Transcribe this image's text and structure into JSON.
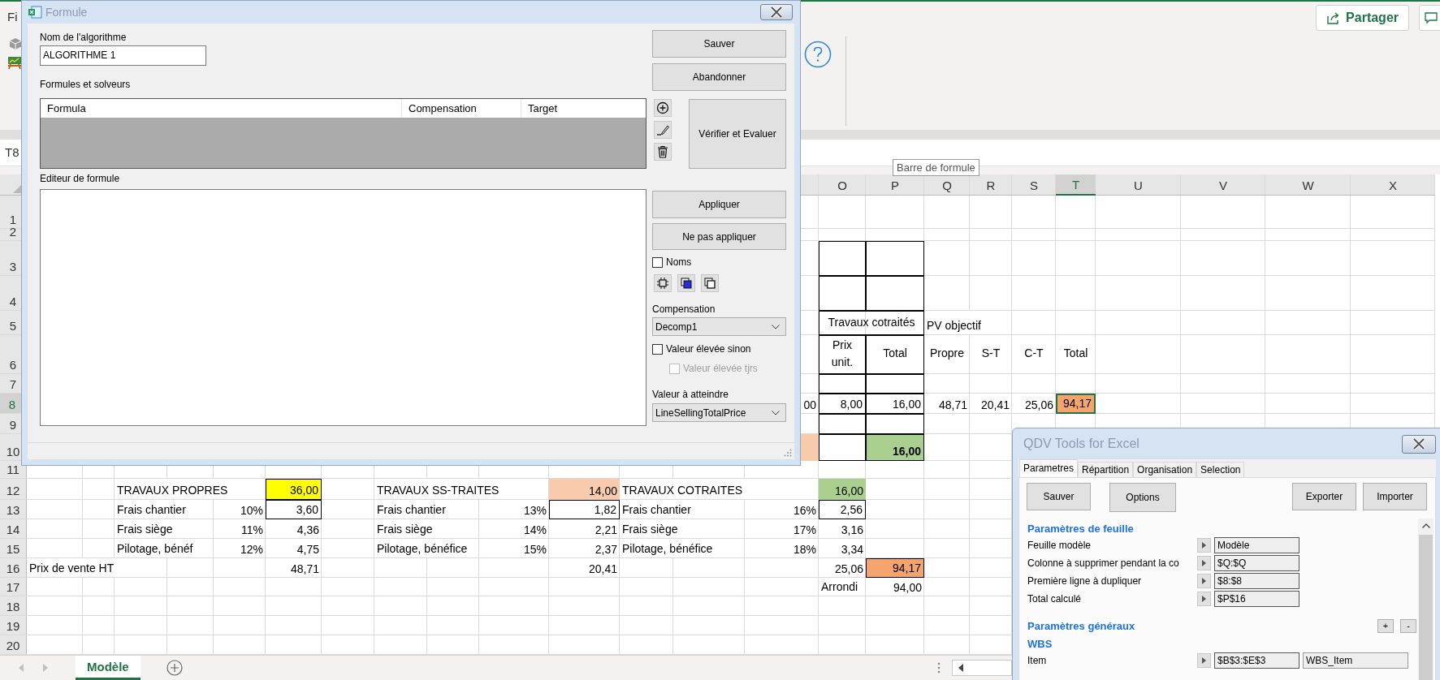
{
  "app": {
    "menu_fragment": "Fi",
    "share_button": "Partager",
    "name_box": "T8",
    "tooltip": "Barre de formule"
  },
  "sheet": {
    "column_headers": [
      {
        "label": "O",
        "selected": false
      },
      {
        "label": "P",
        "selected": false
      },
      {
        "label": "Q",
        "selected": false
      },
      {
        "label": "R",
        "selected": false
      },
      {
        "label": "S",
        "selected": false
      },
      {
        "label": "T",
        "selected": true
      },
      {
        "label": "U",
        "selected": false
      },
      {
        "label": "V",
        "selected": false
      },
      {
        "label": "W",
        "selected": false
      },
      {
        "label": "X",
        "selected": false
      }
    ],
    "rows": [
      {
        "number": "1",
        "selected": false
      },
      {
        "number": "2",
        "selected": false
      },
      {
        "number": "3",
        "selected": false,
        "cells": [
          "",
          "",
          "",
          "",
          "",
          "",
          "",
          "",
          "",
          "",
          "",
          "",
          "",
          "",
          {
            "kind": "blank",
            "boxed": true,
            "selected": false
          },
          {
            "kind": "blank",
            "boxed": true,
            "selected": false
          }
        ]
      },
      {
        "number": "4",
        "selected": false,
        "cells": [
          "",
          "",
          "",
          "",
          "",
          "",
          "",
          "",
          "",
          "",
          "",
          "",
          "",
          "",
          {
            "kind": "blank",
            "boxed": true,
            "selected": false
          },
          {
            "kind": "blank",
            "boxed": true,
            "selected": false
          }
        ]
      },
      {
        "number": "5",
        "selected": false,
        "cells": [
          "",
          "",
          "",
          "",
          "",
          "",
          "",
          "",
          "",
          "",
          "",
          "",
          "",
          "",
          {
            "kind": "merged",
            "text": "Travaux cotraités",
            "boxed": true,
            "selected": false
          },
          "",
          {
            "kind": "text",
            "text": "PV objectif",
            "boxed": false,
            "selected": false
          }
        ]
      },
      {
        "number": "6",
        "selected": false,
        "cells": [
          "",
          "",
          "",
          "",
          "",
          "",
          "",
          "",
          "",
          "",
          "",
          "",
          "",
          "",
          {
            "kind": "heading",
            "text": "Prix unit.",
            "boxed": true,
            "selected": false
          },
          {
            "kind": "heading",
            "text": "Total",
            "boxed": true,
            "selected": false
          },
          {
            "kind": "heading",
            "text": "Propre",
            "boxed": false,
            "selected": false
          },
          {
            "kind": "heading",
            "text": "S-T",
            "boxed": false,
            "selected": false
          },
          {
            "kind": "heading",
            "text": "C-T",
            "boxed": false,
            "selected": false
          },
          {
            "kind": "heading",
            "text": "Total",
            "boxed": false,
            "selected": false
          }
        ]
      },
      {
        "number": "7",
        "selected": false,
        "cells": [
          "",
          "",
          "",
          "",
          "",
          "",
          "",
          "",
          "",
          "",
          "",
          "",
          "",
          "",
          {
            "kind": "blank",
            "boxed": true,
            "selected": false
          },
          {
            "kind": "blank",
            "boxed": true,
            "selected": false
          }
        ]
      },
      {
        "number": "8",
        "selected": true,
        "cells": [
          "",
          "",
          "",
          "",
          "",
          "",
          "",
          "",
          "",
          "",
          "",
          "",
          "",
          {
            "kind": "number",
            "text": "00",
            "boxed": false,
            "selected": false
          },
          {
            "kind": "number",
            "text": "8,00",
            "boxed": true,
            "selected": false
          },
          {
            "kind": "number",
            "text": "16,00",
            "boxed": true,
            "selected": false
          },
          {
            "kind": "number",
            "text": "48,71",
            "boxed": false,
            "selected": false
          },
          {
            "kind": "number",
            "text": "20,41",
            "boxed": false,
            "selected": false
          },
          {
            "kind": "number",
            "text": "25,06",
            "boxed": false,
            "selected": false
          },
          {
            "kind": "number",
            "text": "94,17",
            "color": "#f4a46c",
            "boxed": false,
            "selected": true
          }
        ]
      },
      {
        "number": "9",
        "selected": false,
        "cells": [
          "",
          "",
          "",
          "",
          "",
          "",
          "",
          "",
          "",
          "",
          "",
          "",
          "",
          "",
          {
            "kind": "blank",
            "boxed": true,
            "selected": false
          },
          {
            "kind": "blank",
            "boxed": true,
            "selected": false
          }
        ]
      },
      {
        "number": "10",
        "selected": false,
        "cells": [
          "",
          "",
          "",
          "",
          "",
          "",
          "",
          "",
          "",
          "",
          "",
          "",
          "",
          {
            "kind": "blank",
            "color": "#f8cbad",
            "boxed": false,
            "selected": false
          },
          {
            "kind": "blank",
            "boxed": true,
            "selected": false
          },
          {
            "kind": "number",
            "text": "16,00",
            "bold": true,
            "color": "#a9d08e",
            "boxed": true,
            "selected": false
          }
        ]
      },
      {
        "number": "11",
        "selected": false
      },
      {
        "number": "12",
        "selected": false,
        "cells": [
          "",
          "",
          {
            "kind": "text",
            "text": "TRAVAUX PROPRES",
            "boxed": false,
            "selected": false
          },
          "",
          "",
          {
            "kind": "number",
            "text": "36,00",
            "color": "#ffff00",
            "boxed": true,
            "selected": false
          },
          "",
          {
            "kind": "text",
            "text": "TRAVAUX SS-TRAITES",
            "boxed": false,
            "selected": false
          },
          "",
          "",
          {
            "kind": "number",
            "text": "14,00",
            "color": "#f8cbad",
            "boxed": false,
            "selected": false
          },
          {
            "kind": "text",
            "text": "TRAVAUX COTRAITES",
            "boxed": false,
            "selected": false
          },
          "",
          "",
          {
            "kind": "number",
            "text": "16,00",
            "color": "#a9d08e",
            "boxed": false,
            "selected": false
          }
        ]
      },
      {
        "number": "13",
        "selected": false,
        "cells": [
          "",
          "",
          {
            "kind": "text",
            "text": "Frais chantier",
            "boxed": false,
            "selected": false
          },
          "",
          {
            "kind": "number",
            "text": "10%",
            "boxed": false,
            "selected": false
          },
          {
            "kind": "number",
            "text": "3,60",
            "boxed": true,
            "selected": false
          },
          "",
          {
            "kind": "text",
            "text": "Frais chantier",
            "boxed": false,
            "selected": false
          },
          "",
          {
            "kind": "number",
            "text": "13%",
            "boxed": false,
            "selected": false
          },
          {
            "kind": "number",
            "text": "1,82",
            "boxed": true,
            "selected": false
          },
          {
            "kind": "text",
            "text": "Frais chantier",
            "boxed": false,
            "selected": false
          },
          "",
          {
            "kind": "number",
            "text": "16%",
            "boxed": false,
            "selected": false
          },
          {
            "kind": "number",
            "text": "2,56",
            "boxed": true,
            "selected": false
          }
        ]
      },
      {
        "number": "14",
        "selected": false,
        "cells": [
          "",
          "",
          {
            "kind": "text",
            "text": "Frais siège",
            "boxed": false,
            "selected": false
          },
          "",
          {
            "kind": "number",
            "text": "11%",
            "boxed": false,
            "selected": false
          },
          {
            "kind": "number",
            "text": "4,36",
            "boxed": false,
            "selected": false
          },
          "",
          {
            "kind": "text",
            "text": "Frais siège",
            "boxed": false,
            "selected": false
          },
          "",
          {
            "kind": "number",
            "text": "14%",
            "boxed": false,
            "selected": false
          },
          {
            "kind": "number",
            "text": "2,21",
            "boxed": false,
            "selected": false
          },
          {
            "kind": "text",
            "text": "Frais siège",
            "boxed": false,
            "selected": false
          },
          "",
          {
            "kind": "number",
            "text": "17%",
            "boxed": false,
            "selected": false
          },
          {
            "kind": "number",
            "text": "3,16",
            "boxed": false,
            "selected": false
          }
        ]
      },
      {
        "number": "15",
        "selected": false,
        "cells": [
          "",
          "",
          {
            "kind": "text",
            "text": "Pilotage, bénéf",
            "boxed": false,
            "selected": false
          },
          "",
          {
            "kind": "number",
            "text": "12%",
            "boxed": false,
            "selected": false
          },
          {
            "kind": "number",
            "text": "4,75",
            "boxed": false,
            "selected": false
          },
          "",
          {
            "kind": "text",
            "text": "Pilotage, bénéfice",
            "boxed": false,
            "selected": false
          },
          "",
          {
            "kind": "number",
            "text": "15%",
            "boxed": false,
            "selected": false
          },
          {
            "kind": "number",
            "text": "2,37",
            "boxed": false,
            "selected": false
          },
          {
            "kind": "text",
            "text": "Pilotage, bénéfice",
            "boxed": false,
            "selected": false
          },
          "",
          {
            "kind": "number",
            "text": "18%",
            "boxed": false,
            "selected": false
          },
          {
            "kind": "number",
            "text": "3,34",
            "boxed": false,
            "selected": false
          }
        ]
      },
      {
        "number": "16",
        "selected": false,
        "cells": [
          {
            "kind": "text",
            "text": "Prix de vente HT",
            "boxed": false,
            "selected": false
          },
          "",
          "",
          "",
          "",
          {
            "kind": "number",
            "text": "48,71",
            "boxed": false,
            "selected": false
          },
          "",
          "",
          "",
          "",
          {
            "kind": "number",
            "text": "20,41",
            "boxed": false,
            "selected": false
          },
          "",
          "",
          "",
          {
            "kind": "number",
            "text": "25,06",
            "boxed": false,
            "selected": false
          },
          {
            "kind": "number",
            "text": "94,17",
            "color": "#f4a46c",
            "boxed": true,
            "selected": false
          }
        ]
      },
      {
        "number": "17",
        "selected": false,
        "cells": [
          "",
          "",
          "",
          "",
          "",
          "",
          "",
          "",
          "",
          "",
          "",
          "",
          "",
          "",
          {
            "kind": "text",
            "text": "Arrondi",
            "boxed": false,
            "selected": false
          },
          {
            "kind": "number",
            "text": "94,00",
            "boxed": false,
            "selected": false
          }
        ]
      },
      {
        "number": "18",
        "selected": false
      },
      {
        "number": "19",
        "selected": false
      },
      {
        "number": "20",
        "selected": false
      }
    ]
  },
  "sheet_tabs": [
    {
      "label": "Modèle",
      "selected": true
    }
  ],
  "formula_dialog": {
    "title": "Formule",
    "active": false,
    "name_label": "Nom de l'algorithme",
    "name_value": "ALGORITHME 1",
    "list_label": "Formules et solveurs",
    "list_columns": [
      "Formula",
      "Compensation",
      "Target"
    ],
    "editor_label": "Editeur de formule",
    "save_button": "Sauver",
    "cancel_button": "Abandonner",
    "verify_button": "Vérifier et Evaluer",
    "apply_button": "Appliquer",
    "discard_button": "Ne pas appliquer",
    "names_option": {
      "label": "Noms",
      "checked": false,
      "disabled": false
    },
    "compensation_label": "Compensation",
    "compensation_value": "Decomp1",
    "raise_option": {
      "label": "Valeur élevée sinon",
      "checked": false,
      "disabled": false
    },
    "raise_always_option": {
      "label": "Valeur élevée tjrs",
      "checked": false,
      "disabled": true
    },
    "target_label": "Valeur à atteindre",
    "target_value": "LineSellingTotalPrice"
  },
  "qdv_panel": {
    "title": "QDV Tools for Excel",
    "active": false,
    "tabs": [
      {
        "label": "Parametres",
        "selected": true
      },
      {
        "label": "Répartition",
        "selected": false
      },
      {
        "label": "Organisation",
        "selected": false
      },
      {
        "label": "Selection",
        "selected": false
      }
    ],
    "left_buttons": [
      "Sauver",
      "Options"
    ],
    "right_buttons": [
      "Exporter",
      "Importer"
    ],
    "sections": [
      {
        "heading": "Paramètres de feuille",
        "properties": [
          {
            "label": "Feuille modèle",
            "value": "Modèle"
          },
          {
            "label": "Colonne à supprimer pendant la co",
            "value": "$Q:$Q"
          },
          {
            "label": "Première ligne à dupliquer",
            "value": "$8:$8"
          },
          {
            "label": "Total calculé",
            "value": "$P$16"
          }
        ]
      },
      {
        "heading": "Paramètres généraux",
        "buttons": [
          "+",
          "-"
        ]
      },
      {
        "heading": "WBS",
        "properties": [
          {
            "label": "Item",
            "value": "$B$3:$E$3",
            "option": "WBS_Item"
          }
        ]
      }
    ]
  }
}
